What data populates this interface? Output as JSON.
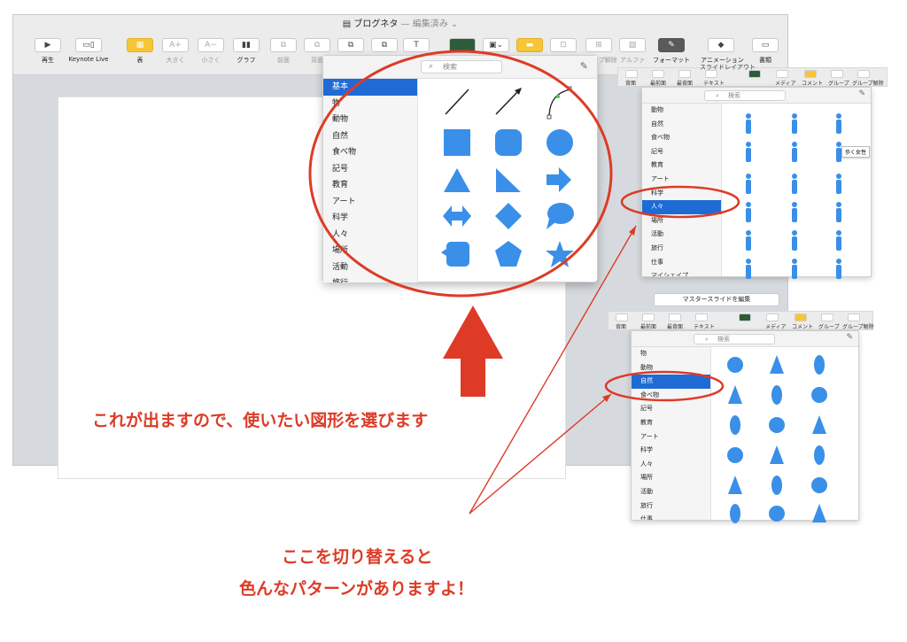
{
  "window": {
    "title": "ブログネタ",
    "title_suffix": "— 編集済み ⌄"
  },
  "toolbar": {
    "items": [
      {
        "icon": "▶",
        "label": "再生"
      },
      {
        "icon": "▭▯",
        "label": "Keynote Live"
      },
      {
        "icon": "▦",
        "label": "表"
      },
      {
        "icon": "A+",
        "label": "大きく"
      },
      {
        "icon": "A−",
        "label": "小さく"
      },
      {
        "icon": "▮▮",
        "label": "グラフ"
      },
      {
        "icon": "⧉",
        "label": "前面"
      },
      {
        "icon": "⧉",
        "label": "背面"
      },
      {
        "icon": "⧉",
        "label": "最前面"
      },
      {
        "icon": "⧉",
        "label": "最背面"
      },
      {
        "icon": "T",
        "label": "テキスト"
      },
      {
        "icon": "■",
        "label": "図形"
      },
      {
        "icon": "▣⌄",
        "label": "メディア"
      },
      {
        "icon": "▬",
        "label": "コメント"
      },
      {
        "icon": "⊡",
        "label": "グループ"
      },
      {
        "icon": "⊞",
        "label": "グループ解除"
      },
      {
        "icon": "▨",
        "label": "アルファ"
      },
      {
        "icon": "✎",
        "label": "フォーマット"
      },
      {
        "icon": "◆",
        "label": "アニメーション"
      },
      {
        "icon": "▭",
        "label": "書類"
      }
    ]
  },
  "shape_popover": {
    "search_placeholder": "検索",
    "categories": [
      "基本",
      "物",
      "動物",
      "自然",
      "食べ物",
      "記号",
      "教育",
      "アート",
      "科学",
      "人々",
      "場所",
      "活動",
      "旅行"
    ],
    "selected": "基本"
  },
  "people_panel": {
    "header_fragment": "マスタースライドを編集",
    "toolbar_labels": [
      "背面",
      "最前面",
      "最背面",
      "テキスト",
      "図形",
      "メディア",
      "コメント",
      "グループ",
      "グループ解除"
    ],
    "top_label": "スライドレイアウト",
    "search_placeholder": "検索",
    "categories": [
      "動物",
      "自然",
      "食べ物",
      "記号",
      "教育",
      "アート",
      "科学",
      "人々",
      "場所",
      "活動",
      "旅行",
      "仕事",
      "マイシェイプ"
    ],
    "selected": "人々",
    "tooltip": "歩く女性"
  },
  "nature_panel": {
    "master_button": "マスタースライドを編集",
    "toolbar_labels": [
      "背面",
      "最前面",
      "最背面",
      "テキスト",
      "図形",
      "メディア",
      "コメント",
      "グループ",
      "グループ解除"
    ],
    "search_placeholder": "検索",
    "categories": [
      "物",
      "動物",
      "自然",
      "食べ物",
      "記号",
      "教育",
      "アート",
      "科学",
      "人々",
      "場所",
      "活動",
      "旅行",
      "仕事"
    ],
    "selected": "自然"
  },
  "annotations": {
    "main": "これが出ますので、使いたい図形を選びます",
    "bottom_line1": "ここを切り替えると",
    "bottom_line2": "色んなパターンがありますよ！"
  },
  "colors": {
    "accent_blue": "#1f6bd6",
    "shape_blue": "#3a8fe8",
    "annotation_red": "#dd3b26"
  }
}
